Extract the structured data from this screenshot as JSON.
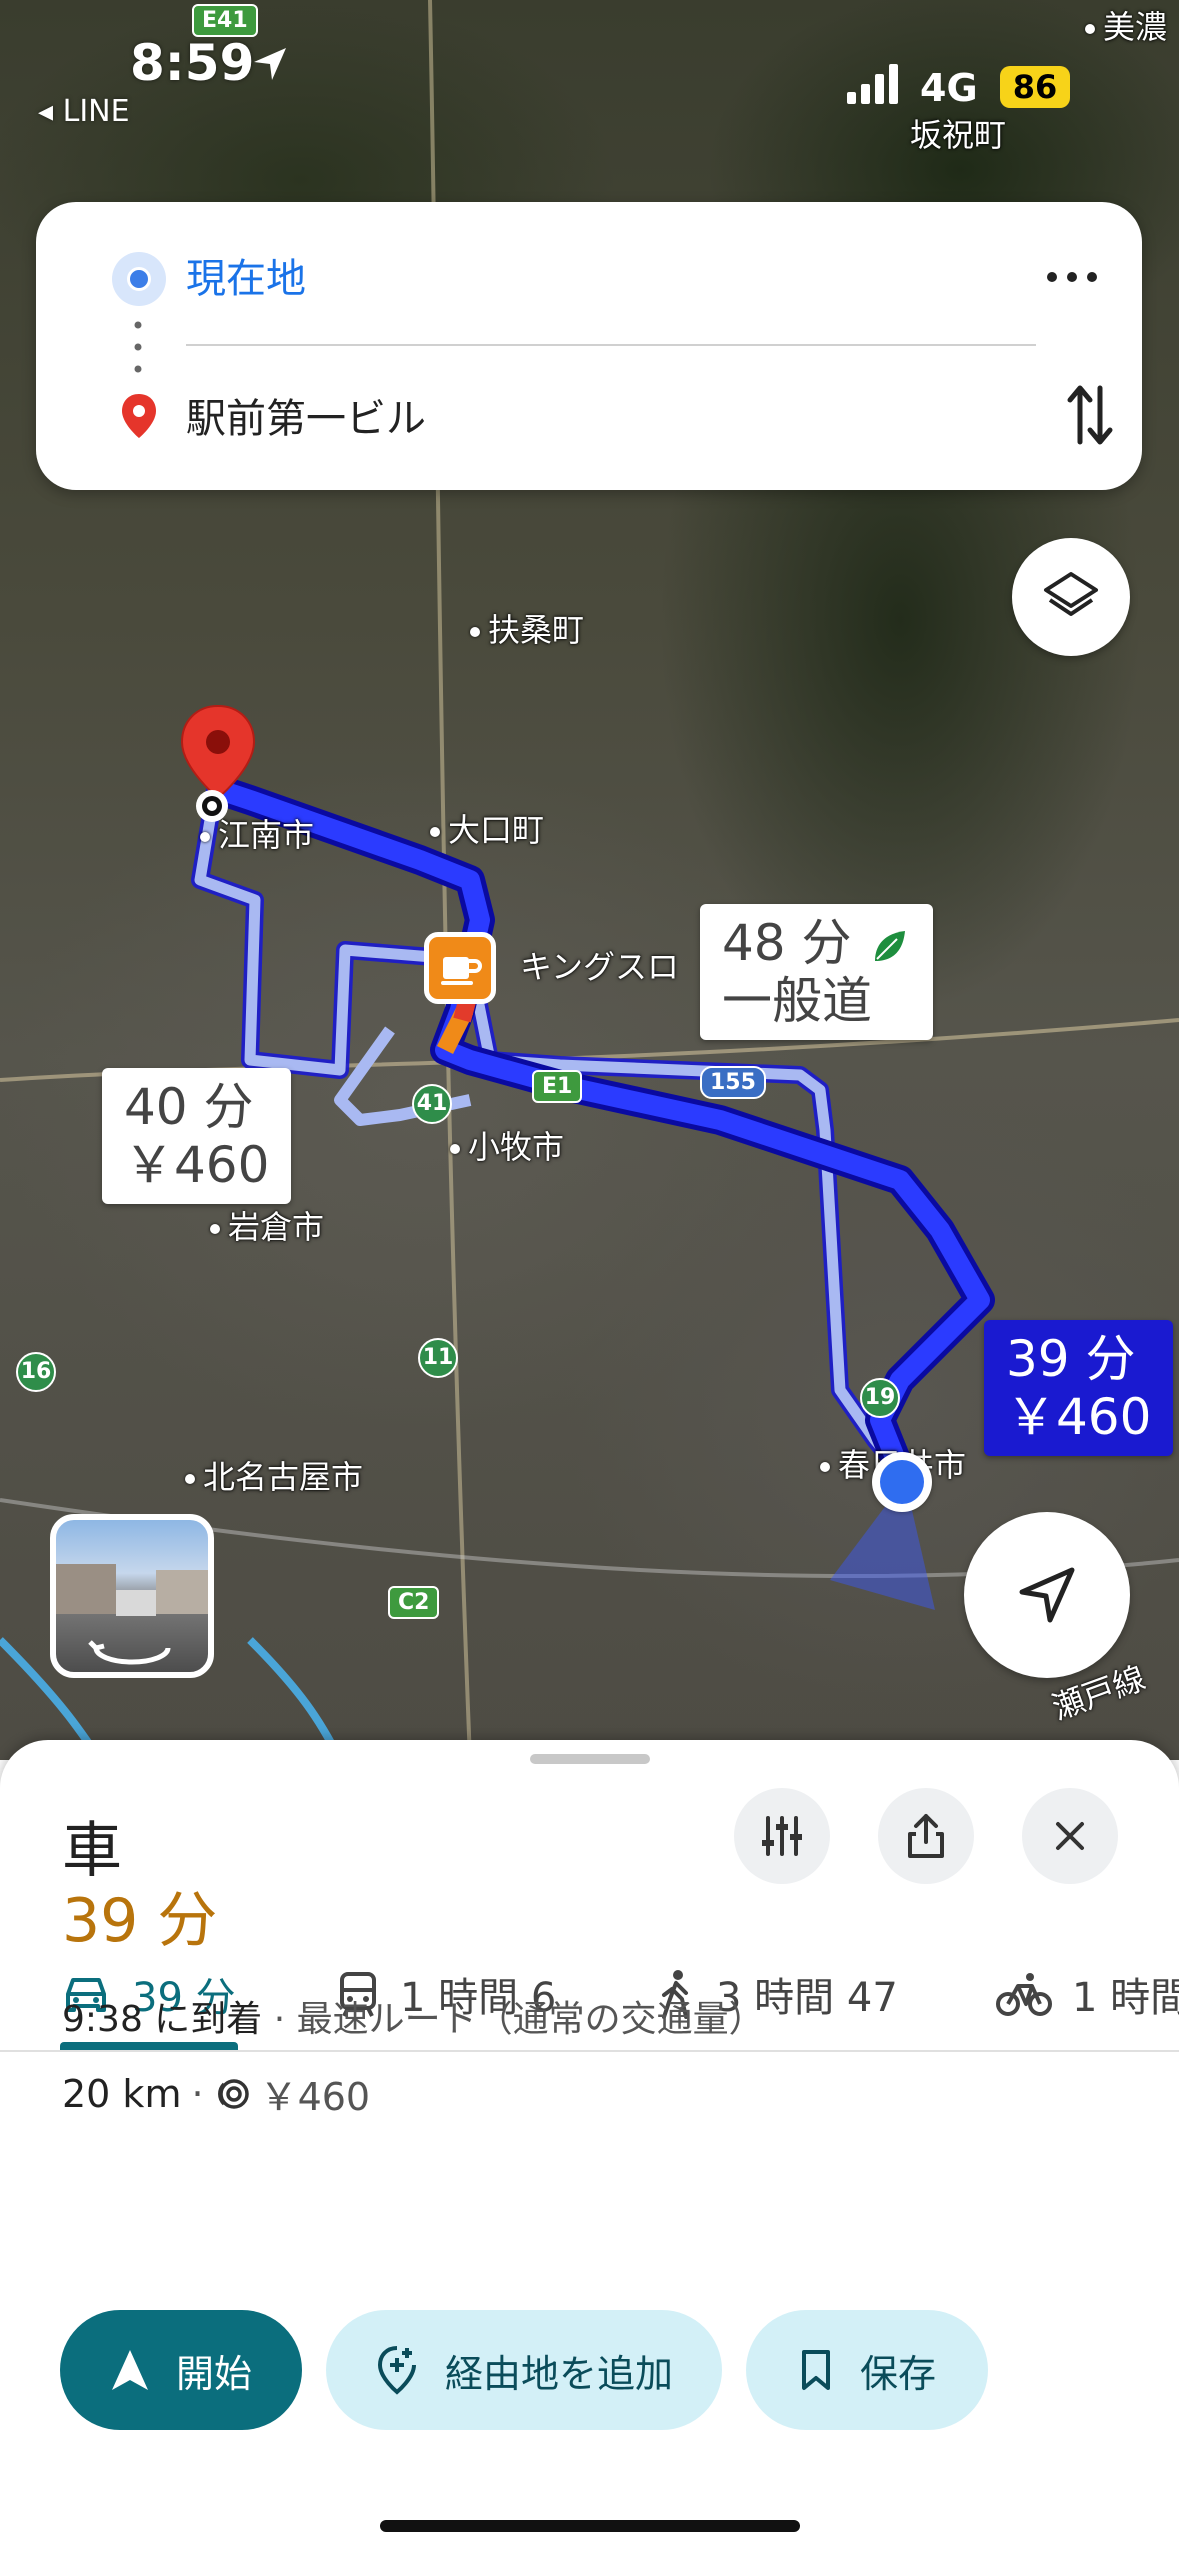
{
  "status_bar": {
    "time": "8:59",
    "back_app": "LINE",
    "network": "4G",
    "battery": "86"
  },
  "search": {
    "from": "現在地",
    "to": "駅前第一ビル"
  },
  "map": {
    "places": [
      {
        "name": "美濃",
        "dot": true
      },
      {
        "name": "坂祝町",
        "dot": false
      },
      {
        "name": "扶桑町",
        "dot": true
      },
      {
        "name": "大口町",
        "dot": true
      },
      {
        "name": "江南市",
        "dot": true
      },
      {
        "name": "キングスロ",
        "dot": false
      },
      {
        "name": "小牧市",
        "dot": true
      },
      {
        "name": "岩倉市",
        "dot": true
      },
      {
        "name": "北名古屋市",
        "dot": true
      },
      {
        "name": "春日井市",
        "dot": true
      },
      {
        "name": "瀬戸線",
        "dot": false
      }
    ],
    "shields": [
      "E41",
      "41",
      "E1",
      "155",
      "16",
      "11",
      "19",
      "C2"
    ],
    "route_labels": [
      {
        "time": "48 分",
        "detail": "一般道",
        "leaf": true
      },
      {
        "time": "40 分",
        "detail": "￥460"
      },
      {
        "time": "39 分",
        "detail": "￥460",
        "selected": true
      }
    ]
  },
  "sheet": {
    "mode_title": "車",
    "tabs": [
      {
        "label": "39 分",
        "icon": "car-icon"
      },
      {
        "label": "1 時間 6",
        "icon": "train-icon"
      },
      {
        "label": "3 時間 47",
        "icon": "walk-icon"
      },
      {
        "label": "1 時間",
        "icon": "bike-icon"
      }
    ],
    "duration": "39 分",
    "arrival_time": "9:38 に到着",
    "route_desc": " · 最速ルート（通常の交通量）",
    "distance": "20 km",
    "toll": "￥460",
    "buttons": {
      "start": "開始",
      "add_stop": "経由地を追加",
      "save": "保存"
    }
  },
  "colors": {
    "accent": "#0b6e7d",
    "duration": "#b8740c",
    "route_selected": "#1a1ad0",
    "route_alt": "#a9b9f2",
    "link_blue": "#1a73e8"
  }
}
